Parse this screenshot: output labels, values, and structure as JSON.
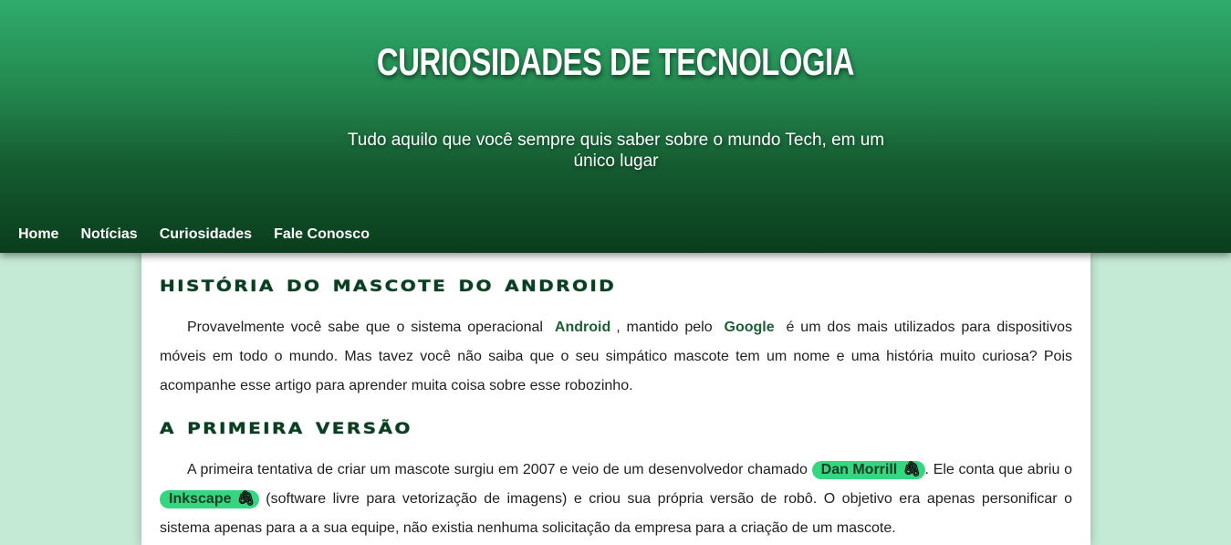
{
  "header": {
    "title": "CURIOSIDADES DE TECNOLOGIA",
    "subtitle": "Tudo aquilo que você sempre quis saber sobre o mundo Tech, em um único lugar"
  },
  "nav": {
    "items": [
      {
        "label": "Home"
      },
      {
        "label": "Notícias"
      },
      {
        "label": "Curiosidades"
      },
      {
        "label": "Fale Conosco"
      }
    ]
  },
  "article": {
    "title": "História do Mascote do Android",
    "intro": {
      "part1": "Provavelmente você sabe que o sistema operacional",
      "brand1": "Android",
      "part2": ", mantido pelo",
      "brand2": "Google",
      "part3": "é um dos mais utilizados para dispositivos móveis em todo o mundo. Mas tavez você não saiba que o seu simpático mascote tem um nome e uma história muito curiosa? Pois acompanhe esse artigo para aprender muita coisa sobre esse robozinho."
    },
    "section1": {
      "title": "A Primeira Versão",
      "part1": "A primeira tentativa de criar um mascote surgiu em 2007 e veio de um desenvolvedor chamado",
      "link1": "Dan Morrill",
      "part2": ". Ele conta que abriu o",
      "link2": "Inkscape",
      "part3": "(software livre para vetorização de imagens) e criou sua própria versão de robô. O objetivo era apenas personificar o sistema apenas para a a sua equipe, não existia nenhuma solicitação da empresa para a criação de um mascote."
    }
  },
  "icons": {
    "link_icon": "paperclip-icon"
  },
  "colors": {
    "header_top": "#30ab6b",
    "header_bottom": "#0a3d1c",
    "page_background": "#c4e9d4",
    "heading": "#0b3d21",
    "brand_text": "#1d5e36",
    "pill_background": "#35d680"
  }
}
